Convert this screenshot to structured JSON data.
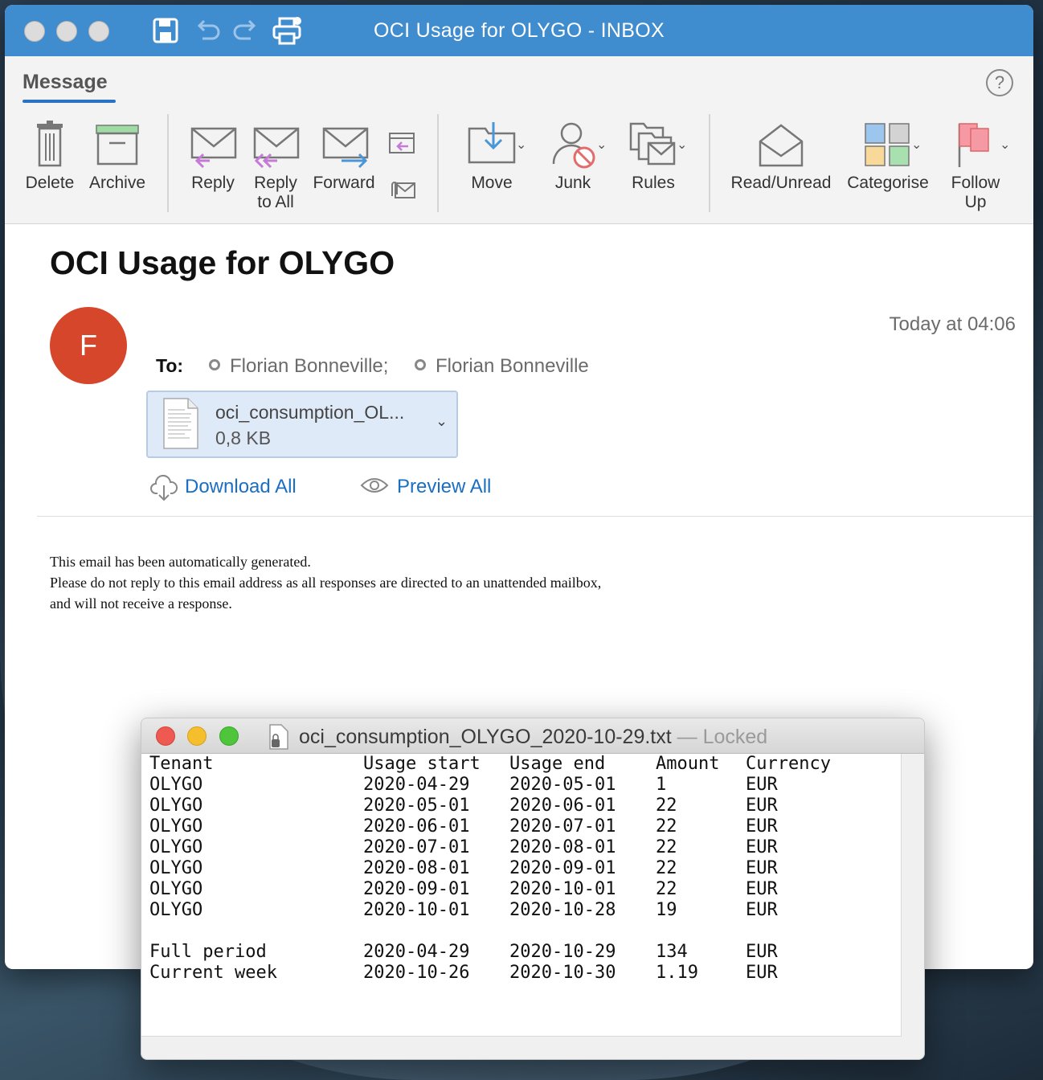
{
  "window": {
    "title": "OCI Usage for OLYGO - INBOX"
  },
  "ribbon": {
    "tab": "Message",
    "help": "?",
    "buttons": {
      "delete": "Delete",
      "archive": "Archive",
      "reply": "Reply",
      "reply_all_1": "Reply",
      "reply_all_2": "to All",
      "forward": "Forward",
      "move": "Move",
      "junk": "Junk",
      "rules": "Rules",
      "read_unread": "Read/Unread",
      "categorise": "Categorise",
      "follow_up_1": "Follow",
      "follow_up_2": "Up"
    },
    "icons": [
      "save-icon",
      "undo-icon",
      "redo-icon",
      "print-icon",
      "delete-icon",
      "archive-icon",
      "reply-icon",
      "reply-all-icon",
      "forward-icon",
      "meeting-reply-icon",
      "attach-forward-icon",
      "move-icon",
      "junk-icon",
      "rules-icon",
      "read-unread-icon",
      "categorise-icon",
      "follow-up-flag-icon"
    ]
  },
  "message": {
    "subject": "OCI Usage for OLYGO",
    "avatar_initial": "F",
    "timestamp": "Today at 04:06",
    "to_label": "To:",
    "recipients": [
      "Florian Bonneville;",
      "Florian Bonneville"
    ],
    "attachment": {
      "name": "oci_consumption_OL...",
      "size": "0,8 KB"
    },
    "download_all": "Download All",
    "preview_all": "Preview All",
    "body": [
      "This email has been automatically generated.",
      "Please do not reply to this email address as all responses are directed to an unattended mailbox,",
      "and will not receive a response."
    ]
  },
  "preview": {
    "filename": "oci_consumption_OLYGO_2020-10-29.txt",
    "status": " — Locked",
    "table": {
      "headers": [
        "Tenant",
        "Usage start",
        "Usage end",
        "Amount",
        "Currency"
      ],
      "rows": [
        [
          "OLYGO",
          "2020-04-29",
          "2020-05-01",
          "1",
          "EUR"
        ],
        [
          "OLYGO",
          "2020-05-01",
          "2020-06-01",
          "22",
          "EUR"
        ],
        [
          "OLYGO",
          "2020-06-01",
          "2020-07-01",
          "22",
          "EUR"
        ],
        [
          "OLYGO",
          "2020-07-01",
          "2020-08-01",
          "22",
          "EUR"
        ],
        [
          "OLYGO",
          "2020-08-01",
          "2020-09-01",
          "22",
          "EUR"
        ],
        [
          "OLYGO",
          "2020-09-01",
          "2020-10-01",
          "22",
          "EUR"
        ],
        [
          "OLYGO",
          "2020-10-01",
          "2020-10-28",
          "19",
          "EUR"
        ]
      ],
      "summary": [
        [
          "Full period",
          "2020-04-29",
          "2020-10-29",
          "134",
          "EUR"
        ],
        [
          "Current week",
          "2020-10-26",
          "2020-10-30",
          "1.19",
          "EUR"
        ]
      ]
    }
  },
  "colors": {
    "titlebar": "#3f8ccf",
    "link": "#1a6fc2",
    "avatar": "#d6462a",
    "tab_underline": "#2a72c4"
  }
}
